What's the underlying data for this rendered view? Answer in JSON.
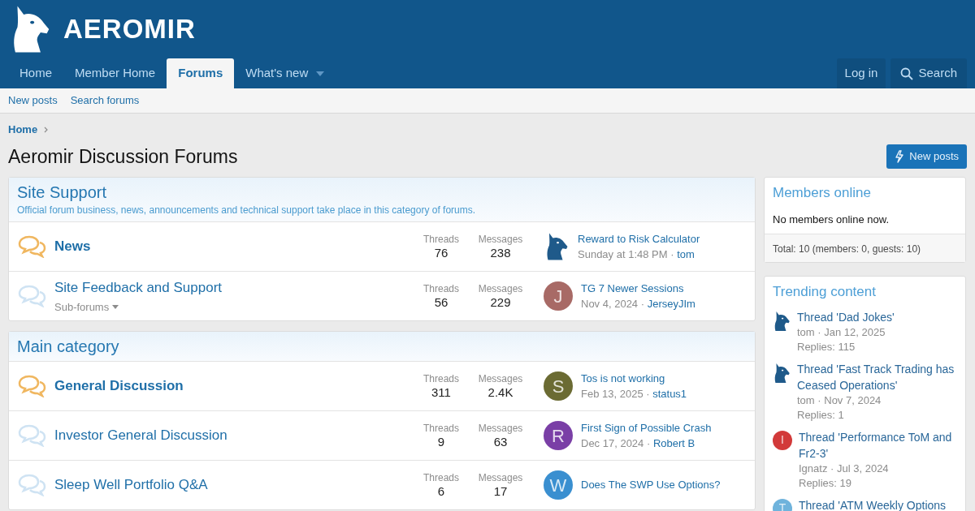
{
  "logo": {
    "text": "AEROMIR"
  },
  "nav": [
    {
      "label": "Home",
      "selected": false,
      "dropdown": false
    },
    {
      "label": "Member Home",
      "selected": false,
      "dropdown": false
    },
    {
      "label": "Forums",
      "selected": true,
      "dropdown": false
    },
    {
      "label": "What's new",
      "selected": false,
      "dropdown": true
    }
  ],
  "nav_right": {
    "login": "Log in",
    "search": "Search"
  },
  "subnav": [
    "New posts",
    "Search forums"
  ],
  "breadcrumb": [
    "Home"
  ],
  "page_title": "Aeromir Discussion Forums",
  "new_posts_button": "New posts",
  "categories": [
    {
      "title": "Site Support",
      "description": "Official forum business, news, announcements and technical support take place in this category of forums.",
      "forums": [
        {
          "name": "News",
          "unread": true,
          "threads_label": "Threads",
          "threads": "76",
          "messages_label": "Messages",
          "messages": "238",
          "last_title": "Reward to Risk Calculator",
          "last_date": "Sunday at 1:48 PM ·",
          "last_user": "tom",
          "avatar": {
            "kind": "logo"
          }
        },
        {
          "name": "Site Feedback and Support",
          "unread": false,
          "subforums": "Sub-forums",
          "threads_label": "Threads",
          "threads": "56",
          "messages_label": "Messages",
          "messages": "229",
          "last_title": "TG 7 Newer Sessions",
          "last_date": "Nov 4, 2024 ·",
          "last_user": "JerseyJIm",
          "avatar": {
            "kind": "letter",
            "letter": "J",
            "color": "#a86a66"
          }
        }
      ]
    },
    {
      "title": "Main category",
      "forums": [
        {
          "name": "General Discussion",
          "unread": true,
          "threads_label": "Threads",
          "threads": "311",
          "messages_label": "Messages",
          "messages": "2.4K",
          "last_title": "Tos is not working",
          "last_date": "Feb 13, 2025 ·",
          "last_user": "status1",
          "avatar": {
            "kind": "letter",
            "letter": "S",
            "color": "#6b6b33"
          }
        },
        {
          "name": "Investor General Discussion",
          "unread": false,
          "threads_label": "Threads",
          "threads": "9",
          "messages_label": "Messages",
          "messages": "63",
          "last_title": "First Sign of Possible Crash",
          "last_date": "Dec 17, 2024 ·",
          "last_user": "Robert B",
          "avatar": {
            "kind": "letter",
            "letter": "R",
            "color": "#7a3fa6"
          }
        },
        {
          "name": "Sleep Well Portfolio Q&A",
          "unread": false,
          "threads_label": "Threads",
          "threads": "6",
          "messages_label": "Messages",
          "messages": "17",
          "last_title": "Does The SWP Use Options?",
          "avatar": {
            "kind": "letter",
            "letter": "W",
            "color": "#3a8fd0"
          }
        }
      ]
    }
  ],
  "members_online": {
    "title": "Members online",
    "text": "No members online now.",
    "total": "Total: 10 (members: 0, guests: 10)"
  },
  "trending": {
    "title": "Trending content",
    "items": [
      {
        "title": "Thread 'Dad Jokes'",
        "user": "tom",
        "date": "· Jan 12, 2025",
        "replies": "Replies: 115",
        "avatar": {
          "kind": "logo"
        }
      },
      {
        "title": "Thread 'Fast Track Trading has Ceased Operations'",
        "user": "tom",
        "date": "· Nov 7, 2024",
        "replies": "Replies: 1",
        "avatar": {
          "kind": "logo"
        }
      },
      {
        "title": "Thread 'Performance ToM and Fr2-3'",
        "user": "Ignatz",
        "date": "· Jul 3, 2024",
        "replies": "Replies: 19",
        "avatar": {
          "kind": "letter",
          "letter": "I",
          "color": "#d23a3a"
        }
      },
      {
        "title": "Thread 'ATM Weekly Options",
        "avatar": {
          "kind": "letter",
          "letter": "T",
          "color": "#6fb3dc"
        }
      }
    ]
  }
}
